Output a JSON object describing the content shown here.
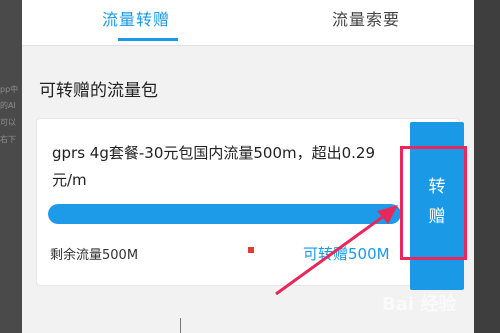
{
  "tabs": [
    {
      "label": "流量转赠",
      "active": true
    },
    {
      "label": "流量索要",
      "active": false
    }
  ],
  "section_title": "可转赠的流量包",
  "package": {
    "name": "gprs 4g套餐-30元包国内流量500m，超出0.29元/m",
    "remaining_label": "剩余流量500M",
    "transferable_label": "可转赠500M",
    "remaining_fraction": 1.0,
    "action_label": "转赠"
  },
  "background_text": [
    "pp中",
    "的AI",
    "可以",
    "右下"
  ],
  "watermark": "Bai 经验",
  "colors": {
    "accent": "#1a9ae6",
    "highlight": "#e8285a"
  },
  "icons": {
    "annotation_arrow": "arrow-pointer-icon"
  }
}
